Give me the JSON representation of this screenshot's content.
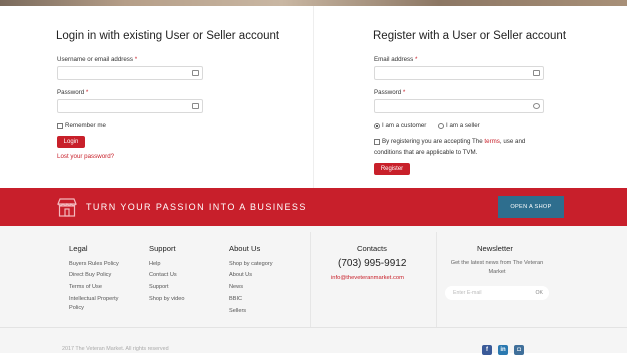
{
  "login": {
    "title": "Login in with existing User or Seller account",
    "username_label": "Username or email address",
    "password_label": "Password",
    "required_mark": "*",
    "remember_label": "Remember me",
    "login_button": "Login",
    "lost_password": "Lost your password?"
  },
  "register": {
    "title": "Register with a User or Seller account",
    "email_label": "Email address",
    "password_label": "Password",
    "required_mark": "*",
    "role_customer": "I am a customer",
    "role_seller": "I am a seller",
    "role_selected": "customer",
    "terms_prefix": "By registering you are accepting The",
    "terms_link": "terms",
    "terms_suffix": ", use and",
    "terms_line2": "conditions that are applicable to TVM.",
    "register_button": "Register"
  },
  "banner": {
    "text": "TURN YOUR PASSION INTO A BUSINESS",
    "button": "OPEN A SHOP",
    "color": "#c81f2b",
    "button_color": "#2e6e8e"
  },
  "footer": {
    "legal": {
      "heading": "Legal",
      "links": [
        "Buyers Rules Policy",
        "Direct Buy Policy",
        "Terms of Use",
        "Intellectual Property",
        "Policy"
      ]
    },
    "support": {
      "heading": "Support",
      "links": [
        "Help",
        "Contact Us",
        "Support",
        "Shop by video"
      ]
    },
    "about": {
      "heading": "About Us",
      "links": [
        "Shop by category",
        "About Us",
        "News",
        "BBIC",
        "Sellers"
      ]
    },
    "contacts": {
      "heading": "Contacts",
      "phone": "(703) 995-9912",
      "email": "info@theveteranmarket.com"
    },
    "newsletter": {
      "heading": "Newsletter",
      "description": "Get the latest news from The Veteran Market",
      "placeholder": "Enter E-mail",
      "submit": "OK"
    },
    "copyright": "2017 The Veteran Market. All rights reserved",
    "social": [
      "facebook-icon",
      "linkedin-icon",
      "instagram-icon"
    ]
  },
  "colors": {
    "accent": "#c8202a"
  }
}
